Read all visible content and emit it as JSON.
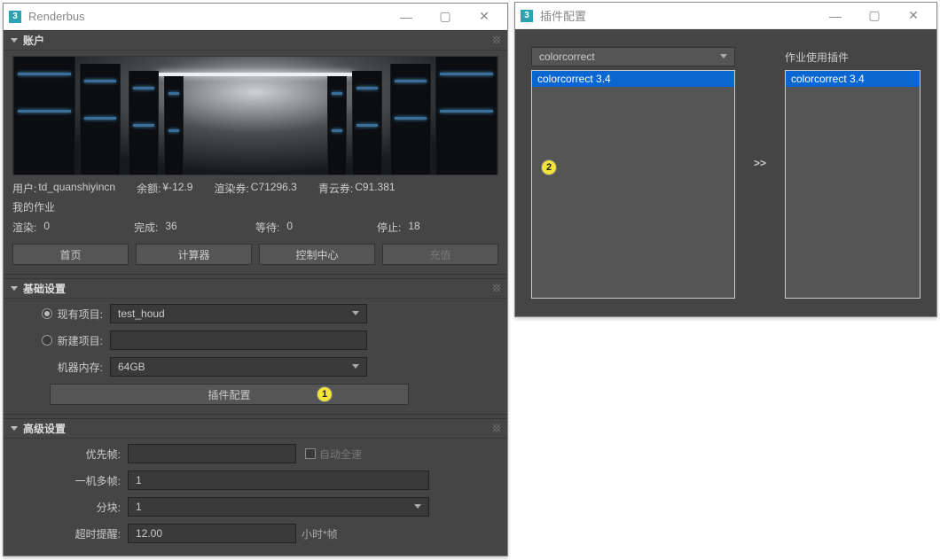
{
  "app_icon_text": "3",
  "main_window": {
    "title": "Renderbus",
    "account": {
      "header": "账户",
      "user_label": "用户:",
      "user_value": "td_quanshiyincn",
      "balance_label": "余额:",
      "balance_value": "¥-12.9",
      "render_credit_label": "渲染券:",
      "render_credit_value": "C71296.3",
      "cloud_credit_label": "青云券:",
      "cloud_credit_value": "C91.381",
      "my_jobs_label": "我的作业",
      "stats": {
        "render_label": "渲染:",
        "render_value": "0",
        "complete_label": "完成:",
        "complete_value": "36",
        "waiting_label": "等待:",
        "waiting_value": "0",
        "stopped_label": "停止:",
        "stopped_value": "18"
      },
      "buttons": {
        "home": "首页",
        "calculator": "计算器",
        "control": "控制中心",
        "recharge": "充值"
      }
    },
    "basic": {
      "header": "基础设置",
      "existing_project": "现有项目:",
      "existing_value": "test_houd",
      "new_project": "新建项目:",
      "ram_label": "机器内存:",
      "ram_value": "64GB",
      "plugin_button": "插件配置",
      "badge": "1"
    },
    "advanced": {
      "header": "高级设置",
      "priority": "优先帧:",
      "auto_full": "自动全速",
      "multi_frame": "一机多帧:",
      "multi_frame_value": "1",
      "chunk": "分块:",
      "chunk_value": "1",
      "timeout": "超时提醒:",
      "timeout_value": "12.00",
      "timeout_unit": "小时*帧"
    }
  },
  "plugin_window": {
    "title": "插件配置",
    "select_value": "colorcorrect",
    "left_item": "colorcorrect 3.4",
    "right_label": "作业使用插件",
    "right_item": "colorcorrect 3.4",
    "transfer": ">>",
    "badge": "2"
  }
}
